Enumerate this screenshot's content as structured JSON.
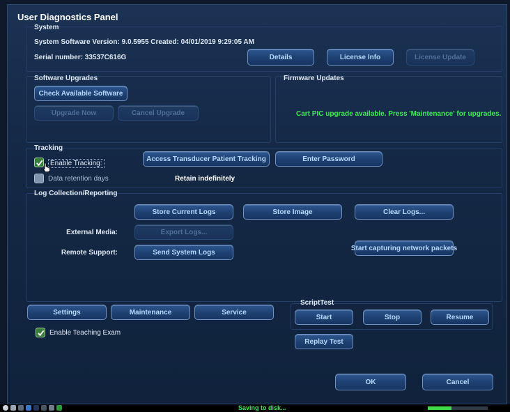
{
  "panel": {
    "title": "User Diagnostics Panel"
  },
  "system": {
    "label": "System",
    "version_text": "System Software Version: 9.0.5955   Created: 04/01/2019  9:29:05 AM",
    "serial_text": "Serial number: 33537C616G",
    "buttons": {
      "details": "Details",
      "license_info": "License Info",
      "license_update": "License Update"
    }
  },
  "software_upgrades": {
    "label": "Software Upgrades",
    "check_available": "Check Available Software",
    "upgrade_now": "Upgrade Now",
    "cancel_upgrade": "Cancel Upgrade"
  },
  "firmware_updates": {
    "label": "Firmware Updates",
    "message": "Cart PIC upgrade available.  Press 'Maintenance' for upgrades.",
    "message_color": "#44e85a"
  },
  "tracking": {
    "label": "Tracking",
    "enable_tracking_label": "Enable Tracking:",
    "enable_tracking_checked": true,
    "retention_label": "Data retention days",
    "retention_checked": false,
    "retention_value": "Retain indefinitely",
    "access_button": "Access Transducer Patient Tracking",
    "password_button": "Enter Password"
  },
  "log_collection": {
    "label": "Log Collection/Reporting",
    "store_logs": "Store Current Logs",
    "store_image": "Store Image",
    "clear_logs": "Clear Logs...",
    "external_media_label": "External Media:",
    "export_logs": "Export Logs...",
    "remote_support_label": "Remote Support:",
    "send_logs": "Send System Logs",
    "capture_packets": "Start capturing network packets"
  },
  "bottom": {
    "settings": "Settings",
    "maintenance": "Maintenance",
    "service": "Service",
    "teaching_label": "Enable Teaching Exam",
    "teaching_checked": true
  },
  "script_test": {
    "label": "ScriptTest",
    "start": "Start",
    "stop": "Stop",
    "resume": "Resume",
    "replay": "Replay Test"
  },
  "dialog": {
    "ok": "OK",
    "cancel": "Cancel"
  },
  "statusbar": {
    "message": "Saving to disk...",
    "progress_fraction": 0.4,
    "icons": [
      "power-icon",
      "network-icon",
      "usb-icon",
      "battery-icon",
      "printer-icon",
      "text-icon",
      "keyboard-icon",
      "signal-icon"
    ]
  },
  "colors": {
    "accent": "#b6d9ff",
    "green": "#44e85a",
    "panel_bg": "#142845"
  }
}
